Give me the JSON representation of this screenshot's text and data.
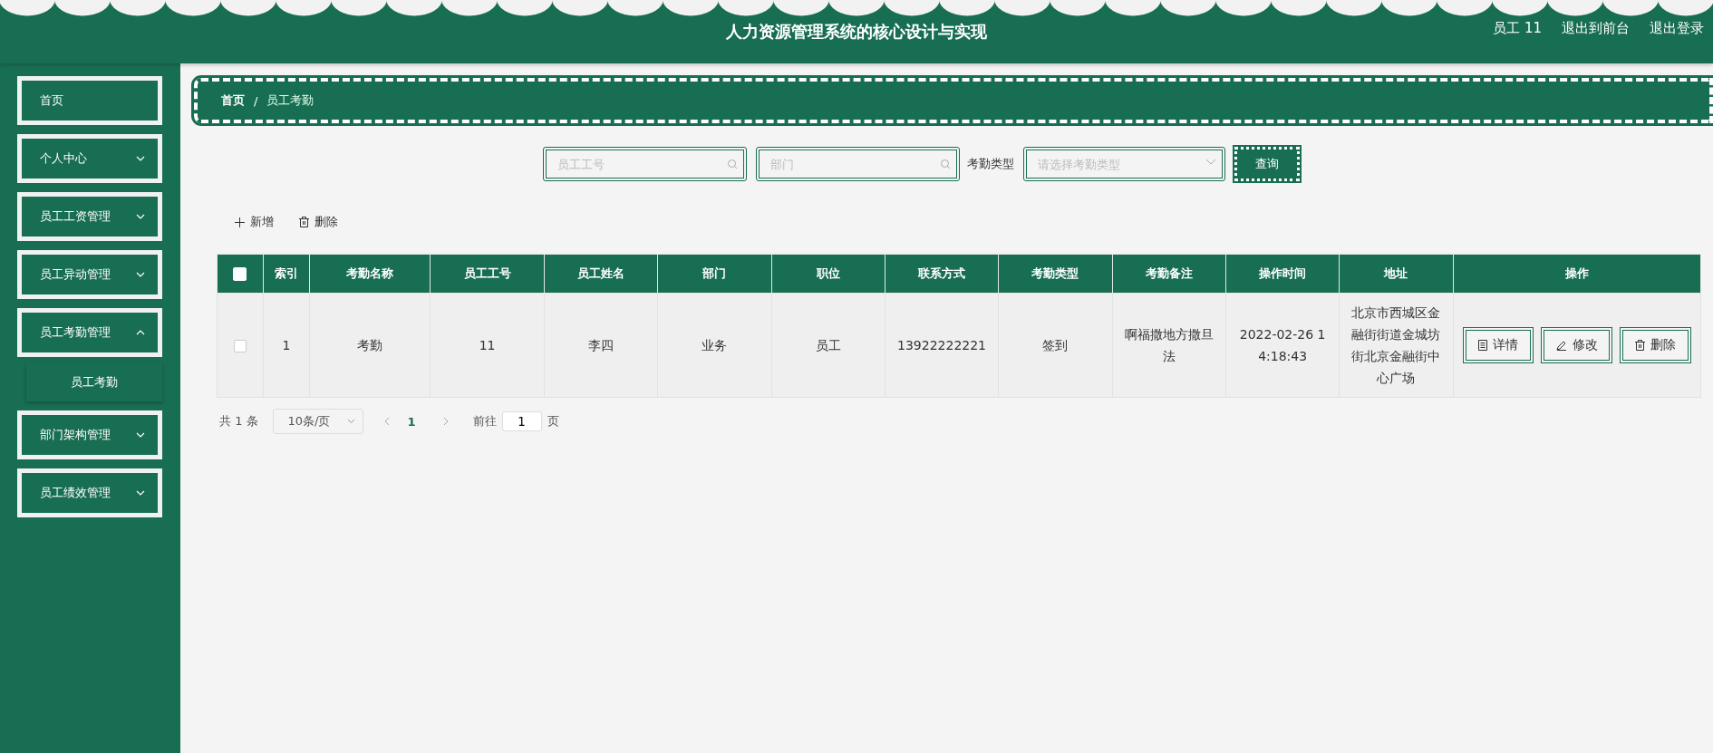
{
  "header": {
    "title": "人力资源管理系统的核心设计与实现",
    "user": "员工 11",
    "links": [
      "退出到前台",
      "退出登录"
    ]
  },
  "sidebar": {
    "items": [
      {
        "label": "首页",
        "kind": "link"
      },
      {
        "label": "个人中心",
        "kind": "menu",
        "expanded": false
      },
      {
        "label": "员工工资管理",
        "kind": "menu",
        "expanded": false
      },
      {
        "label": "员工异动管理",
        "kind": "menu",
        "expanded": false
      },
      {
        "label": "员工考勤管理",
        "kind": "menu",
        "expanded": true,
        "children": [
          {
            "label": "员工考勤"
          }
        ]
      },
      {
        "label": "部门架构管理",
        "kind": "menu",
        "expanded": false
      },
      {
        "label": "员工绩效管理",
        "kind": "menu",
        "expanded": false
      }
    ]
  },
  "breadcrumb": {
    "items": [
      "首页",
      "员工考勤"
    ],
    "separator": "/"
  },
  "search": {
    "fields": [
      {
        "placeholder": "员工工号"
      },
      {
        "placeholder": "部门"
      }
    ],
    "type_label": "考勤类型",
    "type_placeholder": "请选择考勤类型",
    "button": "查询"
  },
  "actions": [
    "新增",
    "删除"
  ],
  "table": {
    "header_checked": false,
    "columns": [
      "索引",
      "考勤名称",
      "员工工号",
      "员工姓名",
      "部门",
      "职位",
      "联系方式",
      "考勤类型",
      "考勤备注",
      "操作时间",
      "地址",
      "操作"
    ],
    "rows": [
      {
        "checked": false,
        "cells": [
          "1",
          "考勤",
          "11",
          "李四",
          "业务",
          "员工",
          "13922222221",
          "签到",
          "啊福撒地方撒旦法",
          "2022-02-26 14:18:43",
          "北京市西城区金融街街道金城坊街北京金融街中心广场"
        ],
        "buttons": [
          "详情",
          "修改",
          "删除"
        ]
      }
    ]
  },
  "pagination": {
    "total": "共 1 条",
    "page_size": "10条/页",
    "current": "1",
    "goto_label": "前往",
    "goto_value": "1",
    "page_suffix": "页"
  }
}
